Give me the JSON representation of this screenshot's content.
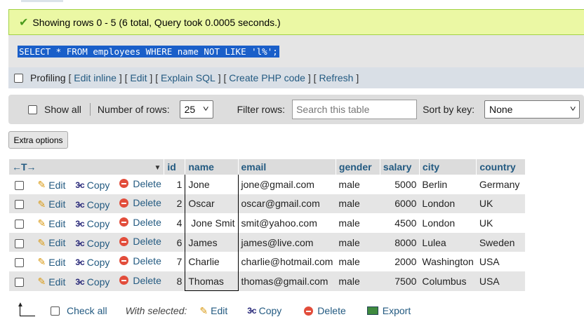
{
  "message": {
    "text": "Showing rows 0 - 5 (6 total, Query took 0.0005 seconds.)"
  },
  "query": {
    "sql": "SELECT * FROM employees WHERE name NOT LIKE 'l%';"
  },
  "profiling": {
    "label": "Profiling",
    "links": [
      "Edit inline",
      "Edit",
      "Explain SQL",
      "Create PHP code",
      "Refresh"
    ]
  },
  "navigation": {
    "show_all": "Show all",
    "rows_label": "Number of rows:",
    "rows_value": "25",
    "filter_label": "Filter rows:",
    "filter_placeholder": "Search this table",
    "sort_label": "Sort by key:",
    "sort_value": "None"
  },
  "extra_options": "Extra options",
  "table": {
    "arrows": "←T→",
    "columns": [
      "id",
      "name",
      "email",
      "gender",
      "salary",
      "city",
      "country"
    ],
    "actions": {
      "edit": "Edit",
      "copy": "Copy",
      "delete": "Delete"
    },
    "rows": [
      {
        "id": "1",
        "name": "Jone",
        "email": "jone@gmail.com",
        "gender": "male",
        "salary": "5000",
        "city": "Berlin",
        "country": "Germany"
      },
      {
        "id": "2",
        "name": "Oscar",
        "email": "oscar@gmail.com",
        "gender": "male",
        "salary": "6000",
        "city": "London",
        "country": "UK"
      },
      {
        "id": "4",
        "name": " Jone Smit",
        "email": "smit@yahoo.com",
        "gender": "male",
        "salary": "4500",
        "city": "London",
        "country": "UK"
      },
      {
        "id": "6",
        "name": "James",
        "email": "james@live.com",
        "gender": "male",
        "salary": "8000",
        "city": "Lulea",
        "country": "Sweden"
      },
      {
        "id": "7",
        "name": "Charlie",
        "email": "charlie@hotmail.com",
        "gender": "male",
        "salary": "2000",
        "city": "Washington",
        "country": "USA"
      },
      {
        "id": "8",
        "name": "Thomas",
        "email": "thomas@gmail.com",
        "gender": "male",
        "salary": "7500",
        "city": "Columbus",
        "country": "USA"
      }
    ]
  },
  "bottom": {
    "check_all": "Check all",
    "with_selected": "With selected:",
    "edit": "Edit",
    "copy": "Copy",
    "delete": "Delete",
    "export": "Export"
  }
}
